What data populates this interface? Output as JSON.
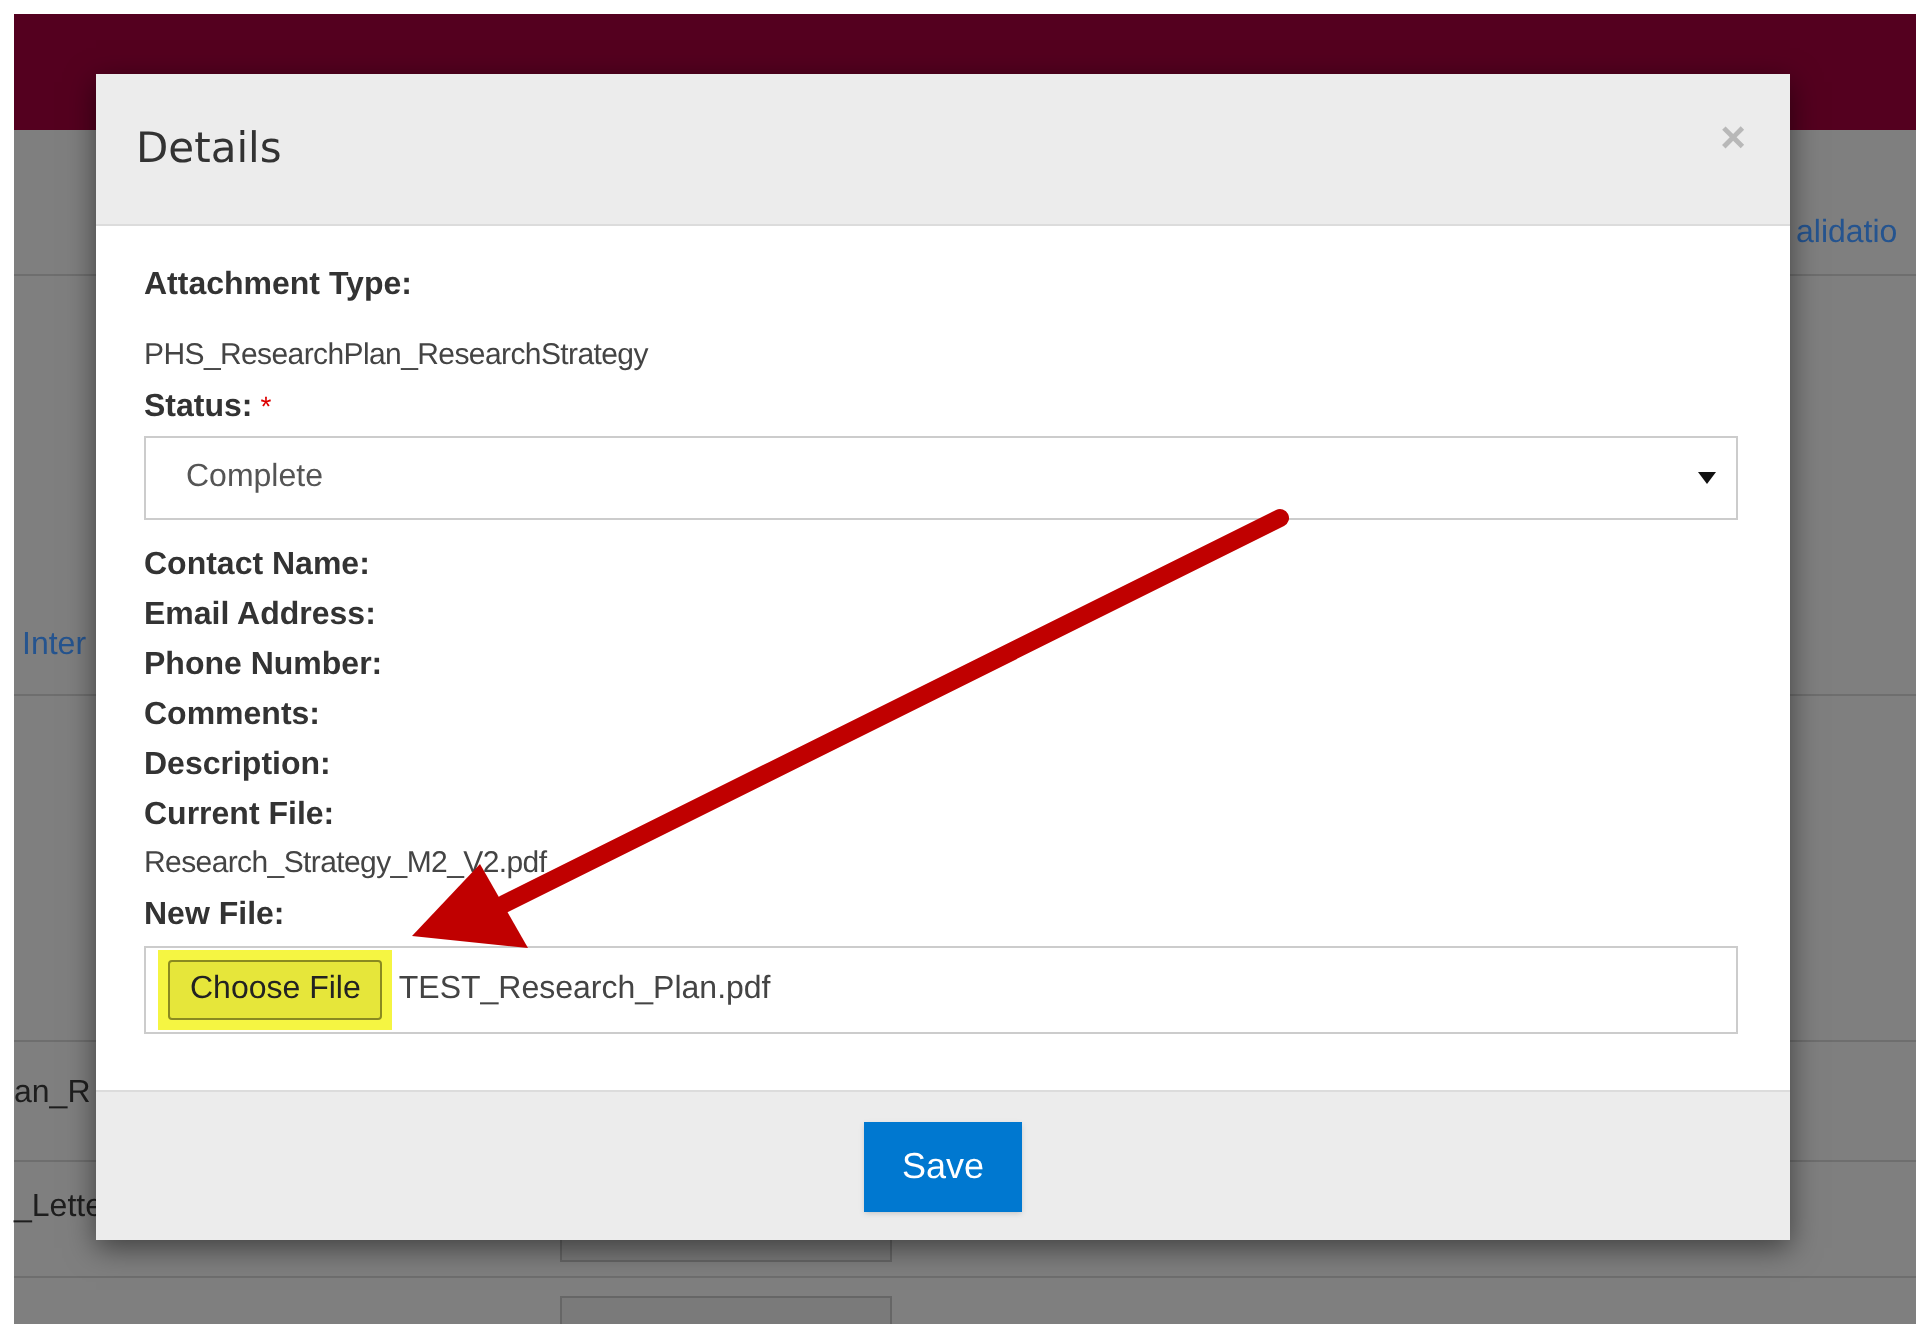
{
  "background": {
    "texts": [
      {
        "kind": "link",
        "text": "alidatio"
      },
      {
        "kind": "link",
        "text": "Inter"
      },
      {
        "kind": "cell",
        "text": "an_R"
      },
      {
        "kind": "cell",
        "text": "_Lette"
      }
    ]
  },
  "dialog": {
    "title": "Details",
    "close": "×",
    "fields": [
      {
        "kind": "label",
        "text": "Attachment Type:"
      },
      {
        "kind": "value",
        "text": "PHS_ResearchPlan_ResearchStrategy"
      },
      {
        "kind": "label",
        "text": "Status:",
        "required": true,
        "required_mark": "*"
      },
      {
        "kind": "select",
        "value": "Complete"
      },
      {
        "kind": "label",
        "text": "Contact Name:"
      },
      {
        "kind": "label",
        "text": "Email Address:"
      },
      {
        "kind": "label",
        "text": "Phone Number:"
      },
      {
        "kind": "label",
        "text": "Comments:"
      },
      {
        "kind": "label",
        "text": "Description:"
      },
      {
        "kind": "label",
        "text": "Current File:"
      },
      {
        "kind": "value",
        "text": "Research_Strategy_M2_V2.pdf"
      },
      {
        "kind": "label",
        "text": "New File:"
      },
      {
        "kind": "file",
        "button": "Choose File",
        "value": "TEST_Research_Plan.pdf",
        "highlighted": true
      }
    ],
    "save": "Save"
  }
}
